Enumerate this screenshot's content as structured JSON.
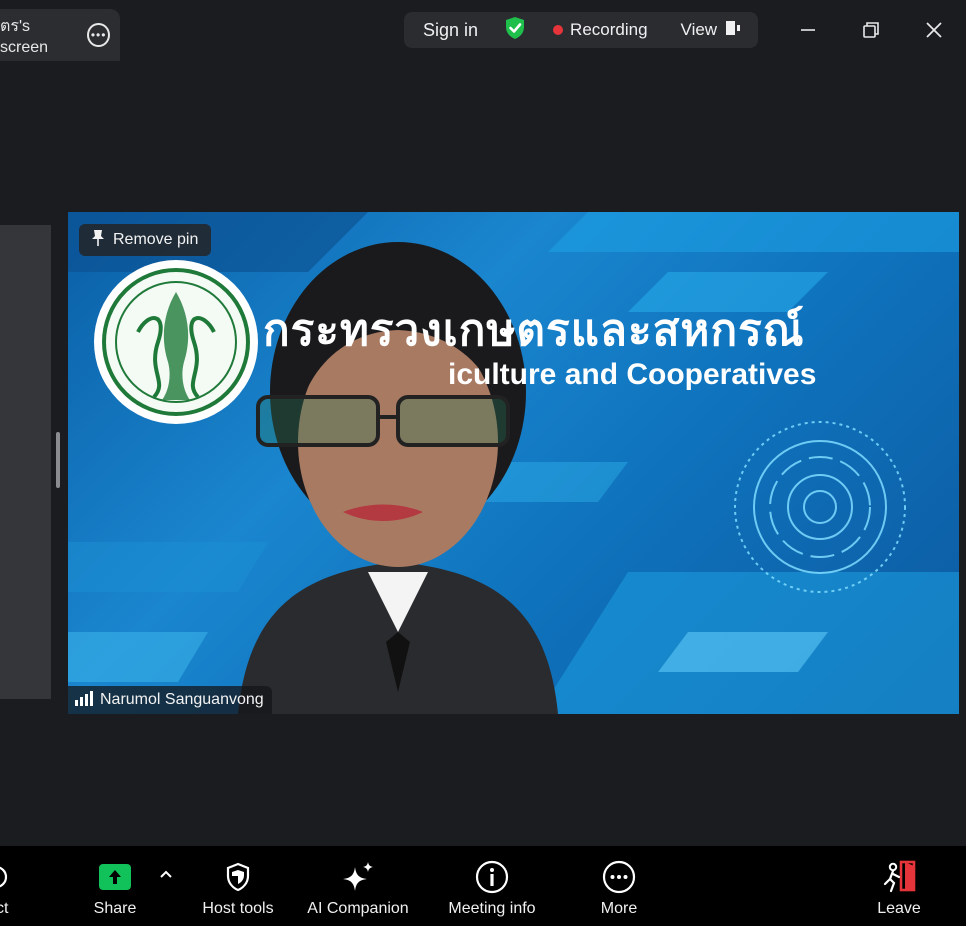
{
  "topbar": {
    "share_tab_label": "ตร's screen",
    "sign_in_label": "Sign in",
    "recording_label": "Recording",
    "view_label": "View"
  },
  "video": {
    "remove_pin_label": "Remove pin",
    "participant_name": "Narumol Sanguanvong",
    "banner_thai": "กระทรวงเกษตรและสหกรณ์",
    "banner_english": "iculture and Cooperatives"
  },
  "toolbar": {
    "partial_left_label": "ct",
    "share_label": "Share",
    "host_tools_label": "Host tools",
    "ai_companion_label": "AI Companion",
    "meeting_info_label": "Meeting info",
    "more_label": "More",
    "leave_label": "Leave"
  },
  "colors": {
    "background": "#1a1c20",
    "share_green": "#11c25b",
    "recording_red": "#e5343a",
    "shield_green": "#1fbf4c",
    "leave_red": "#e5343a"
  },
  "icons": [
    "more-icon",
    "shield-check-icon",
    "recording-dot-icon",
    "view-icon",
    "minimize-icon",
    "restore-icon",
    "close-icon",
    "pin-icon",
    "signal-icon",
    "share-up-arrow-icon",
    "caret-up-icon",
    "host-shield-icon",
    "sparkle-icon",
    "info-icon",
    "more-dots-icon",
    "leave-icon"
  ]
}
